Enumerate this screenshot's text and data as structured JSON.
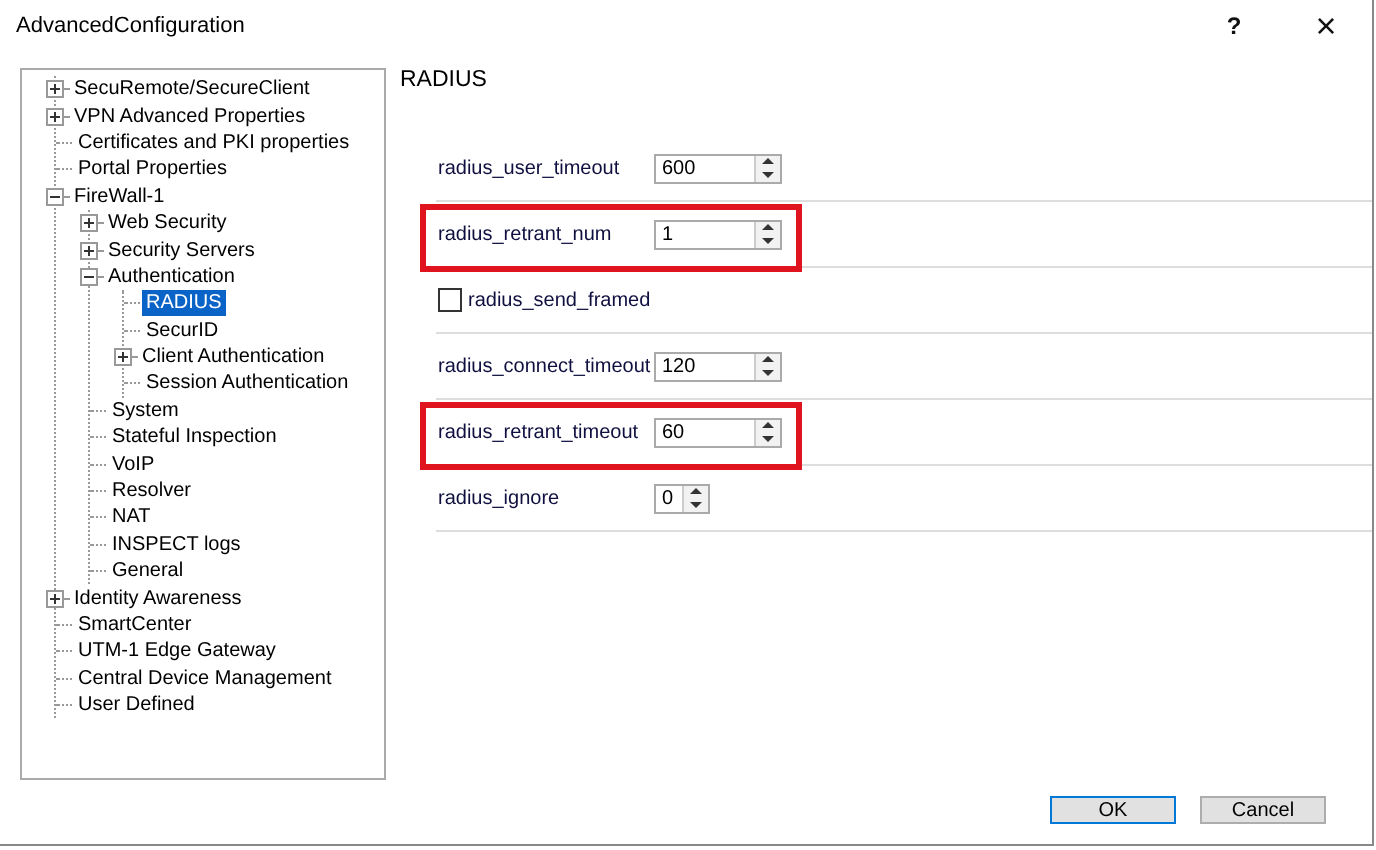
{
  "window": {
    "title": "AdvancedConfiguration",
    "help": "?",
    "close": "×"
  },
  "tree": [
    {
      "label": "SecuRemote/SecureClient",
      "expanded": false,
      "selected": false
    },
    {
      "label": "VPN Advanced Properties",
      "expanded": false,
      "selected": false
    },
    {
      "label": "Certificates and PKI properties",
      "selected": false
    },
    {
      "label": "Portal Properties",
      "selected": false
    },
    {
      "label": "FireWall-1",
      "expanded": true,
      "selected": false,
      "children": [
        {
          "label": "Web Security",
          "expanded": false,
          "selected": false
        },
        {
          "label": "Security Servers",
          "expanded": false,
          "selected": false
        },
        {
          "label": "Authentication",
          "expanded": true,
          "selected": false,
          "children": [
            {
              "label": "RADIUS",
              "selected": true
            },
            {
              "label": "SecurID",
              "selected": false
            },
            {
              "label": "Client Authentication",
              "expanded": false,
              "selected": false
            },
            {
              "label": "Session Authentication",
              "selected": false
            }
          ]
        },
        {
          "label": "System",
          "selected": false
        },
        {
          "label": "Stateful Inspection",
          "selected": false
        },
        {
          "label": "VoIP",
          "selected": false
        },
        {
          "label": "Resolver",
          "selected": false
        },
        {
          "label": "NAT",
          "selected": false
        },
        {
          "label": "INSPECT logs",
          "selected": false
        },
        {
          "label": "General",
          "selected": false
        }
      ]
    },
    {
      "label": "Identity Awareness",
      "expanded": false,
      "selected": false
    },
    {
      "label": "SmartCenter",
      "selected": false
    },
    {
      "label": "UTM-1 Edge Gateway",
      "selected": false
    },
    {
      "label": "Central Device Management",
      "selected": false
    },
    {
      "label": "User Defined",
      "selected": false
    }
  ],
  "panel": {
    "heading": "RADIUS",
    "rows": [
      {
        "kind": "spin",
        "label": "radius_user_timeout",
        "value": "600",
        "highlighted": false
      },
      {
        "kind": "spin",
        "label": "radius_retrant_num",
        "value": "1",
        "highlighted": true
      },
      {
        "kind": "check",
        "label": "radius_send_framed",
        "checked": false,
        "highlighted": false
      },
      {
        "kind": "spin",
        "label": "radius_connect_timeout",
        "value": "120",
        "highlighted": false
      },
      {
        "kind": "spin",
        "label": "radius_retrant_timeout",
        "value": "60",
        "highlighted": true
      },
      {
        "kind": "short-spin",
        "label": "radius_ignore",
        "value": "0",
        "highlighted": false
      }
    ]
  },
  "buttons": [
    {
      "label": "OK",
      "default": true
    },
    {
      "label": "Cancel",
      "default": false
    }
  ]
}
